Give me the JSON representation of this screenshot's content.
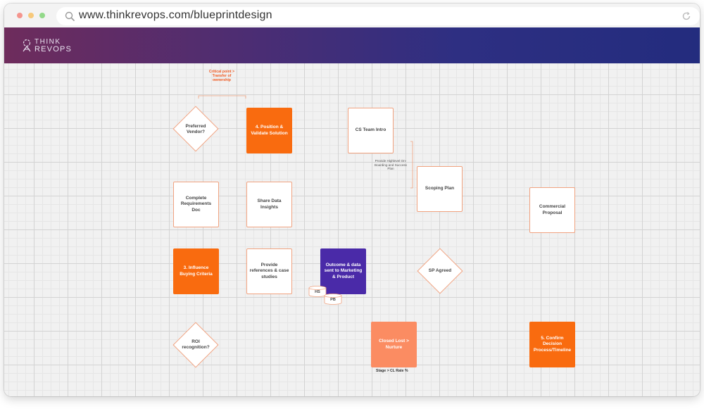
{
  "browser": {
    "url": "www.thinkrevops.com/blueprintdesign"
  },
  "brand": {
    "line1": "THINK",
    "line2": "REVOPS"
  },
  "flow": {
    "critical_note": "Critical point > Transfer of ownership",
    "preferred_vendor": "Preferred Vendor?",
    "position_validate": "4. Position & Validate Solution",
    "cs_team_intro": "CS Team Intro",
    "onboarding_note": "Provide Highlevel On-Boarding and Success Plan",
    "scoping_plan": "Scoping Plan",
    "complete_requirements": "Complete Requirements Doc",
    "share_data": "Share Data Insights",
    "commercial_proposal": "Commercial Proposal",
    "influence_buying": "3. Influence Buying Criteria",
    "provide_references": "Provide references & case studies",
    "outcome_data": "Outcome & data sent to Marketing & Product",
    "hs": "HS",
    "pb": "PB",
    "sp_agreed": "SP Agreed",
    "roi_recognition": "ROI recognition?",
    "closed_lost": "Closed Lost > Nurture",
    "stage_rate": "Stage > CL Rate %",
    "confirm_decision": "5. Confirm Decision Process/Timeline"
  },
  "colors": {
    "orange": "#f96b0f",
    "purple": "#4a2aa8",
    "salmon": "#fb8c62",
    "header_start": "#6e2c5c",
    "header_end": "#232c7e"
  }
}
